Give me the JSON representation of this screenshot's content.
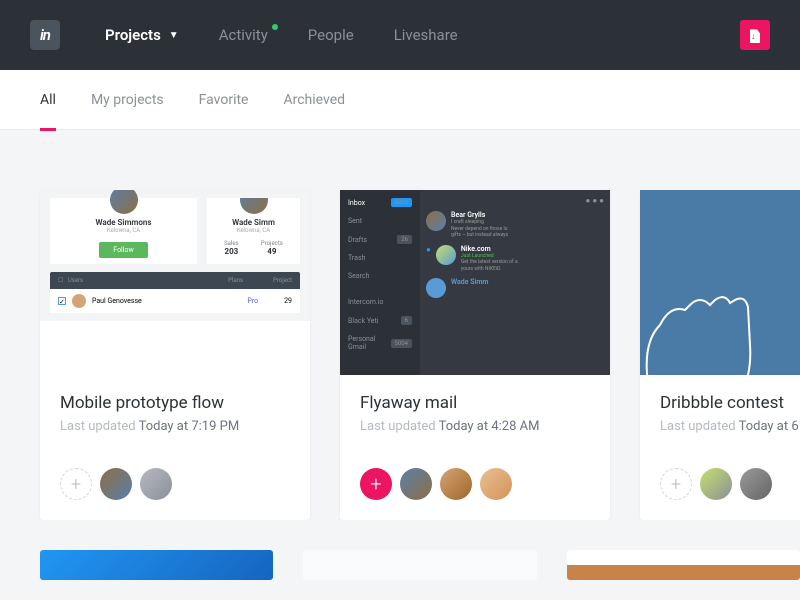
{
  "header": {
    "logo": "in",
    "nav": {
      "projects": "Projects",
      "activity": "Activity",
      "people": "People",
      "liveshare": "Liveshare"
    }
  },
  "tabs": {
    "all": "All",
    "my_projects": "My projects",
    "favorite": "Favorite",
    "archived": "Archieved"
  },
  "cards": [
    {
      "title": "Mobile prototype flow",
      "updated_label": "Last updated ",
      "updated_time": "Today at 7:19 PM",
      "thumb": {
        "profile_name": "Wade Simmons",
        "profile_name2": "Wade Simm",
        "location": "Kelowna, CA",
        "follow": "Follow",
        "stats": {
          "sales_label": "Sales",
          "sales": "203",
          "projects_label": "Projects",
          "projects": "49"
        },
        "table_head": {
          "col1": "Users",
          "col2": "Plans",
          "col3": "Project"
        },
        "row": {
          "name": "Paul Genovesse",
          "plan": "Pro",
          "num": "29"
        }
      }
    },
    {
      "title": "Flyaway mail",
      "updated_label": "Last updated ",
      "updated_time": "Today at 4:28 AM",
      "thumb": {
        "side": {
          "inbox": "Inbox",
          "inbox_count": "5033",
          "sent": "Sent",
          "drafts": "Drafts",
          "drafts_count": "26",
          "trash": "Trash",
          "search": "Search",
          "intercom": "Intercom.io",
          "blackyeti": "Black Yeti",
          "blackyeti_count": "6",
          "personal": "Personal Gmail",
          "personal_count": "5004"
        },
        "items": {
          "bear_name": "Bear Grylls",
          "bear_sub": "I craft sleeping",
          "bear_text": "Never depend on those lu\ngifts – but instead always",
          "nike_name": "Nike.com",
          "nike_sub": "Just Launched",
          "nike_text": "Get the latest version of a\nyours with NIKEiD.",
          "wade": "Wade Simm"
        }
      }
    },
    {
      "title": "Dribbble contest",
      "updated_label": "Last updated ",
      "updated_time": "Today at 6"
    }
  ]
}
